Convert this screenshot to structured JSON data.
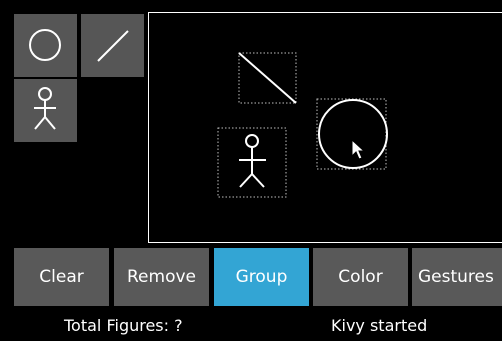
{
  "toolbox": {
    "tools": [
      {
        "icon": "circle-icon"
      },
      {
        "icon": "line-icon"
      },
      {
        "icon": "stickman-icon"
      }
    ]
  },
  "canvas": {
    "figures": [
      {
        "type": "line",
        "selected": true
      },
      {
        "type": "circle",
        "selected": true
      },
      {
        "type": "stickman",
        "selected": true
      }
    ],
    "cursor": "arrow-cursor-icon"
  },
  "buttons": {
    "clear": "Clear",
    "remove": "Remove",
    "group": "Group",
    "color": "Color",
    "gestures": "Gestures"
  },
  "status": {
    "total_figures": "Total Figures: ?",
    "message": "Kivy started"
  },
  "colors": {
    "button_bg": "#595959",
    "active_button_bg": "#33a5d4",
    "canvas_bg": "#000000",
    "stroke": "#ffffff"
  }
}
